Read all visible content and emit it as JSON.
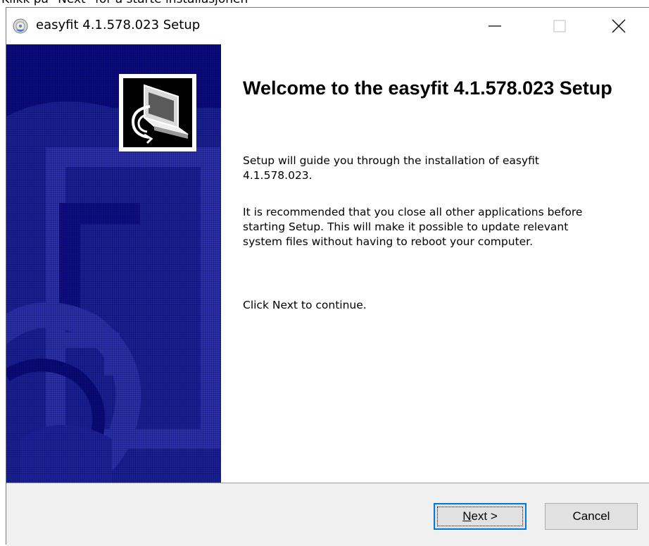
{
  "background_caption": "Klikk på \"Next\" for å starte installasjonen",
  "window": {
    "title": "easyfit 4.1.578.023 Setup",
    "controls": {
      "minimize": "minimize-icon",
      "maximize": "maximize-icon",
      "close": "close-icon"
    }
  },
  "banner": {
    "background_color": "#0b0b85",
    "logo_icon": "installer-computer-icon"
  },
  "content": {
    "heading": "Welcome to the easyfit 4.1.578.023 Setup",
    "paragraph_1": "Setup will guide you through the installation of easyfit 4.1.578.023.",
    "paragraph_2": "It is recommended that you close all other applications before starting Setup. This will make it possible to update relevant system files without having to reboot your computer.",
    "paragraph_3": "Click Next to continue."
  },
  "buttons": {
    "next_label_mnemonic": "N",
    "next_label_rest": "ext >",
    "cancel_label": "Cancel"
  },
  "colors": {
    "accent_focus": "#0078d7",
    "footer_bg": "#f0f0f0"
  }
}
